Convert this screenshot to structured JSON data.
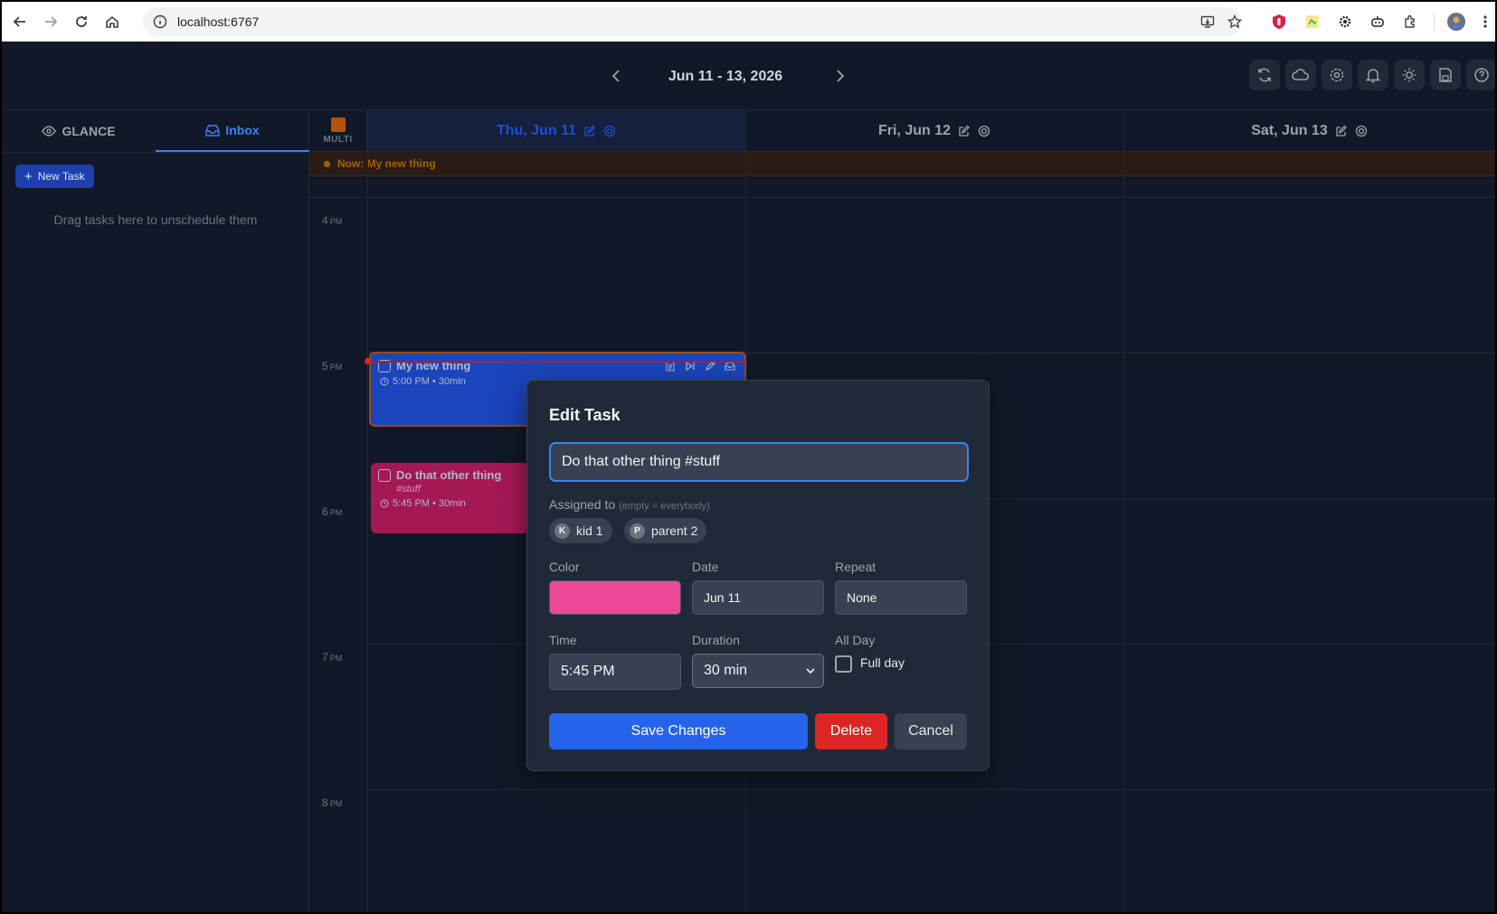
{
  "browser": {
    "url": "localhost:6767"
  },
  "header": {
    "date_range": "Jun 11 - 13, 2026"
  },
  "sidebar": {
    "tabs": [
      {
        "label": "GLANCE",
        "icon": "eye-icon"
      },
      {
        "label": "Inbox",
        "icon": "inbox-icon",
        "active": true
      }
    ],
    "new_task_label": "New Task",
    "drag_hint": "Drag tasks here to unschedule them"
  },
  "calendar": {
    "multi_label": "MULTI",
    "columns": [
      {
        "label": "Thu, Jun 11",
        "today": true
      },
      {
        "label": "Fri, Jun 12"
      },
      {
        "label": "Sat, Jun 13"
      }
    ],
    "now_text": "Now: My new thing",
    "hours": [
      {
        "h": "4",
        "ampm": "PM"
      },
      {
        "h": "5",
        "ampm": "PM"
      },
      {
        "h": "6",
        "ampm": "PM"
      },
      {
        "h": "7",
        "ampm": "PM"
      },
      {
        "h": "8",
        "ampm": "PM"
      }
    ],
    "events": [
      {
        "title": "My new thing",
        "meta": "5:00 PM • 30min",
        "color": "#1d4ed8"
      },
      {
        "title": "Do that other thing",
        "tag": "#stuff",
        "meta": "5:45 PM • 30min",
        "color": "#be185d"
      }
    ]
  },
  "modal": {
    "title": "Edit Task",
    "task_value": "Do that other thing #stuff",
    "assigned_label": "Assigned to",
    "assigned_hint": "(empty = everybody)",
    "assignees": [
      {
        "initial": "K",
        "name": "kid 1"
      },
      {
        "initial": "P",
        "name": "parent 2"
      }
    ],
    "color_label": "Color",
    "color_value": "#ec4899",
    "date_label": "Date",
    "date_value": "Jun 11",
    "repeat_label": "Repeat",
    "repeat_value": "None",
    "time_label": "Time",
    "time_value": "5:45 PM",
    "duration_label": "Duration",
    "duration_value": "30 min",
    "allday_label": "All Day",
    "fullday_label": "Full day",
    "save_label": "Save Changes",
    "delete_label": "Delete",
    "cancel_label": "Cancel"
  }
}
